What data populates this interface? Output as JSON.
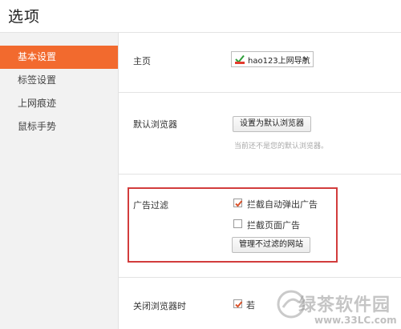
{
  "window": {
    "title": "选项"
  },
  "sidebar": {
    "items": [
      {
        "label": "基本设置",
        "active": true
      },
      {
        "label": "标签设置",
        "active": false
      },
      {
        "label": "上网痕迹",
        "active": false
      },
      {
        "label": "鼠标手势",
        "active": false
      }
    ]
  },
  "homepage": {
    "label": "主页",
    "selected": "hao123上网导航"
  },
  "default_browser": {
    "label": "默认浏览器",
    "button": "设置为默认浏览器",
    "hint": "当前还不是您的默认浏览器。"
  },
  "ad_filter": {
    "label": "广告过滤",
    "block_popups": {
      "label": "拦截自动弹出广告",
      "checked": true
    },
    "block_page_ads": {
      "label": "拦截页面广告",
      "checked": false
    },
    "manage_button": "管理不过滤的网站"
  },
  "on_close": {
    "label": "关闭浏览器时",
    "option": {
      "label": "若",
      "checked": true
    }
  },
  "watermark": {
    "text": "绿茶软件园",
    "url": "www.33LC.com"
  },
  "colors": {
    "accent": "#f26a2e",
    "highlight_border": "#d23c3c",
    "check": "#d9532c"
  },
  "icons": {
    "homepage_logo": "hao123-logo-icon",
    "dropdown": "chevron-down-icon",
    "checkmark": "check-icon"
  }
}
